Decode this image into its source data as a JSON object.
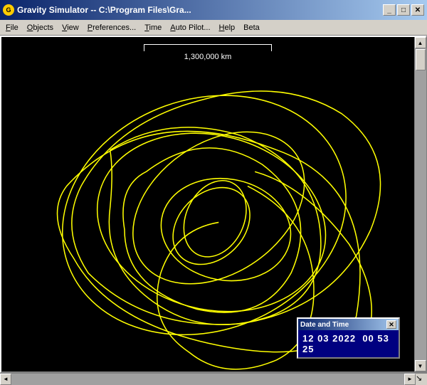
{
  "titlebar": {
    "title": "Gravity Simulator -- C:\\Program Files\\Gra...",
    "icon": "G",
    "buttons": {
      "minimize": "_",
      "maximize": "□",
      "close": "✕"
    }
  },
  "menubar": {
    "items": [
      {
        "label": "File",
        "underline_index": 0
      },
      {
        "label": "Objects",
        "underline_index": 0
      },
      {
        "label": "View",
        "underline_index": 0
      },
      {
        "label": "Preferences...",
        "underline_index": 0
      },
      {
        "label": "Time",
        "underline_index": 0
      },
      {
        "label": "Auto Pilot...",
        "underline_index": 0
      },
      {
        "label": "Help",
        "underline_index": 0
      },
      {
        "label": "Beta",
        "underline_index": 0
      }
    ]
  },
  "scale": {
    "label": "1,300,000 km"
  },
  "datetime": {
    "title": "Date and Time",
    "date": "12 03 2022",
    "time": "00 53 25",
    "close_btn": "✕"
  },
  "scrollbars": {
    "up_arrow": "▲",
    "down_arrow": "▼",
    "left_arrow": "◄",
    "right_arrow": "►",
    "resize_corner": "↘"
  }
}
